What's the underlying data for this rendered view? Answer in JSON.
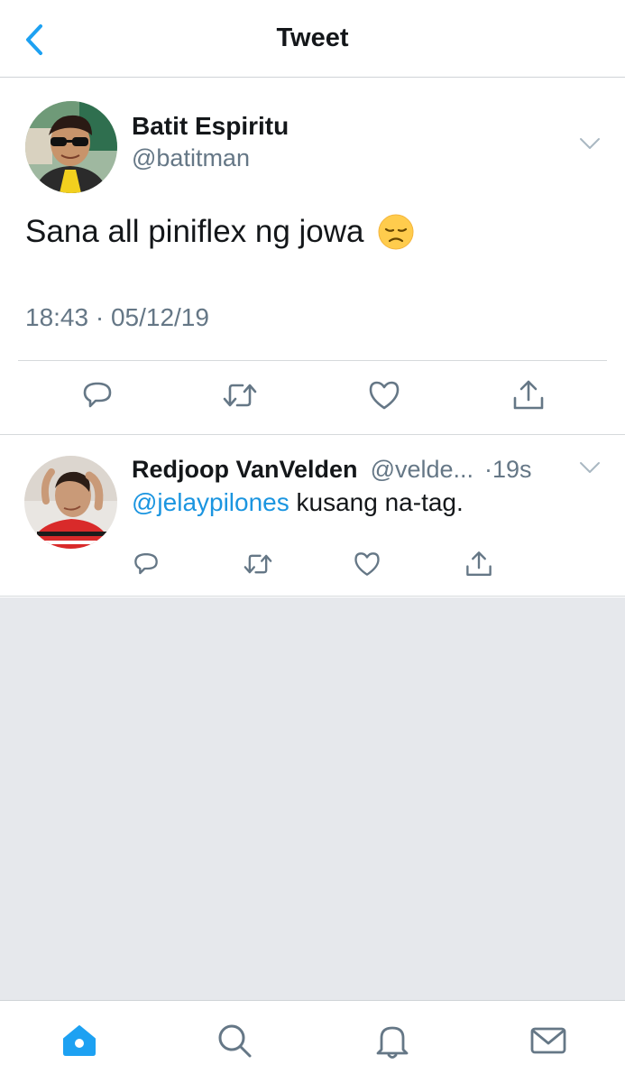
{
  "header": {
    "title": "Tweet",
    "back_icon": "chevron-left-icon"
  },
  "tweet": {
    "author_name": "Batit Espiritu",
    "author_handle": "@batitman",
    "text": "Sana all piniflex ng jowa",
    "emoji": "disappointed-face",
    "timestamp": "18:43 · 05/12/19",
    "actions": [
      "reply-icon",
      "retweet-icon",
      "like-icon",
      "share-icon"
    ]
  },
  "reply": {
    "author_name": "Redjoop VanVelden",
    "author_handle": "@velde...",
    "time": "·19s",
    "mention": "@jelaypilones",
    "text": " kusang na-tag.",
    "actions": [
      "reply-icon",
      "retweet-icon",
      "like-icon",
      "share-icon"
    ]
  },
  "tabbar": {
    "items": [
      "home-icon",
      "search-icon",
      "notifications-icon",
      "messages-icon"
    ],
    "active": "home-icon"
  },
  "colors": {
    "accent": "#1da1f2",
    "link": "#1b95e0",
    "secondary_text": "#657786",
    "empty_background": "#e6e8ec"
  }
}
